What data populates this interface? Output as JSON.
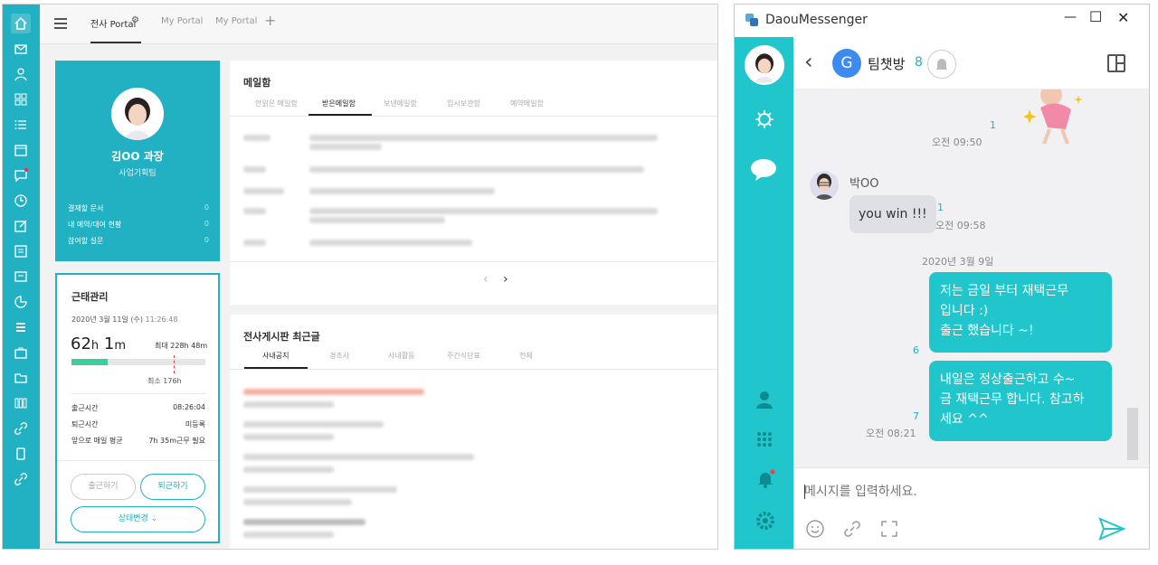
{
  "portal": {
    "tabs": [
      "전사 Portal",
      "My Portal",
      "My Portal"
    ],
    "add_tab": "+",
    "profile": {
      "name": "김OO 과장",
      "dept": "사업기획팀",
      "rows": [
        {
          "label": "결재할 문서",
          "value": "0"
        },
        {
          "label": "내 예약/대여 현황",
          "value": "0"
        },
        {
          "label": "참여할 설문",
          "value": "0"
        }
      ]
    },
    "attendance": {
      "title": "근태관리",
      "date": "2020년 3월 11일 (수)",
      "time": "11:26:48",
      "worked_hours": "62",
      "worked_h_unit": "h",
      "worked_minutes": "1",
      "worked_m_unit": "m",
      "max_label": "최대 228h 48m",
      "min_label": "최소 176h",
      "progress": 0.27,
      "rows": [
        {
          "label": "출근시간",
          "value": "08:26:04"
        },
        {
          "label": "퇴근시간",
          "value": "미등록"
        },
        {
          "label": "앞으로 매일 평균",
          "value": "7h 35m근무 필요"
        }
      ],
      "checkin_button": "출근하기",
      "checkout_button": "퇴근하기",
      "status_button": "상태변경"
    },
    "mail": {
      "title": "메일함",
      "tabs": [
        "안읽은 메일함",
        "받은메일함",
        "보낸메일함",
        "임시보관함",
        "예약메일함"
      ],
      "prev": "‹",
      "next": "›"
    },
    "board": {
      "title": "전사게시판 최근글",
      "tabs": [
        "사내공지",
        "경조사",
        "사내활동",
        "주간식단표",
        "전체"
      ]
    }
  },
  "messenger": {
    "app_title": "DaouMessenger",
    "window_controls": {
      "minimize": "—",
      "maximize": "☐",
      "close": "✕"
    },
    "chat": {
      "group_initial": "G",
      "room_name": "팀챗방",
      "member_count": "8"
    },
    "messages": [
      {
        "type": "sticker-meta",
        "count": "1",
        "time": "오전 09:50"
      },
      {
        "type": "other",
        "sender": "박OO",
        "text": "you win !!!",
        "count": "1",
        "time": "오전 09:58"
      },
      {
        "type": "date",
        "text": "2020년 3월 9일"
      },
      {
        "type": "me",
        "lines": [
          "저는 금일 부터 재택근무",
          "입니다 :)",
          "출근 했습니다 ~!"
        ],
        "count": "6"
      },
      {
        "type": "me",
        "lines": [
          "내일은 정상출근하고 수~",
          "금 재택근무 합니다. 참고하",
          "세요 ^^"
        ],
        "count": "7",
        "time": "오전 08:21"
      }
    ],
    "input_placeholder": "메시지를 입력하세요."
  },
  "colors": {
    "teal": "#21b1c3",
    "messenger_teal": "#21c6cc",
    "group_badge": "#3d8af0",
    "progress": "#3ccf9b"
  }
}
